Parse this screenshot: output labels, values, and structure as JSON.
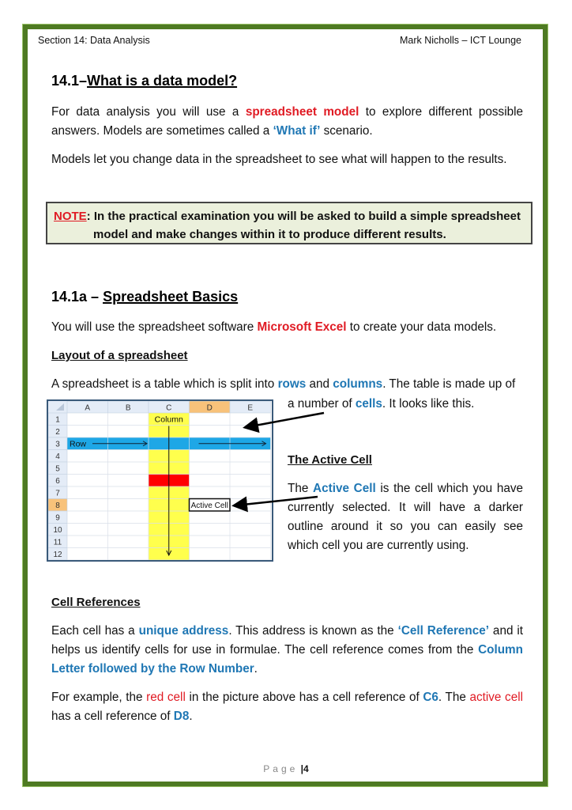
{
  "header": {
    "left": "Section 14: Data Analysis",
    "right": "Mark Nicholls – ICT Lounge"
  },
  "section1": {
    "number": "14.1–",
    "title": "What is a data model?",
    "para1": {
      "pre": "For data analysis you will use a ",
      "highlight": "spreadsheet model",
      "mid": " to explore different possible answers. Models are sometimes called a ",
      "highlight2": "‘What if’",
      "post": " scenario."
    },
    "para2": "Models let you change data in the spreadsheet to see what will happen to the results."
  },
  "note": {
    "label": "NOTE",
    "line1": ": In the practical examination you will be asked to build a simple spreadsheet",
    "line2": "model and make changes within it to produce different results."
  },
  "section1a": {
    "number": "14.1a – ",
    "title": "Spreadsheet Basics",
    "para1": {
      "pre": "You will use the spreadsheet software ",
      "highlight": "Microsoft Excel",
      "post": " to create your data models."
    },
    "layout_heading": "Layout of a spreadsheet",
    "layout_para": {
      "pre": "A spreadsheet is a table which is split into ",
      "rows": "rows",
      "and": " and ",
      "columns": "columns",
      "post": ". The table is made up of",
      "line2_pre": "a number of ",
      "cells": "cells",
      "line2_post": ". It looks like this."
    },
    "active_heading": "The Active Cell",
    "active_para": {
      "pre": "The ",
      "highlight": "Active Cell",
      "post": " is the cell which you have currently selected. It will have a darker outline around it so you can easily see which cell you are currently using."
    }
  },
  "spreadsheet": {
    "columns": [
      "A",
      "B",
      "C",
      "D",
      "E"
    ],
    "rows": [
      "1",
      "2",
      "3",
      "4",
      "5",
      "6",
      "7",
      "8",
      "9",
      "10",
      "11",
      "12"
    ],
    "column_label": "Column",
    "row_label": "Row",
    "active_cell_label": "Active Cell",
    "highlighted_column": "C",
    "highlighted_row": "3",
    "red_cell": "C6",
    "active_cell": "D8",
    "colors": {
      "column_fill": "#ffff4d",
      "row_fill": "#1ea7e6",
      "red_cell": "#ff0000",
      "header_active": "#f8c27a",
      "header": "#e4ecf7"
    }
  },
  "cell_refs": {
    "heading": "Cell References",
    "para1": {
      "pre": "Each cell has a ",
      "h1": "unique address",
      "mid": ". This address is known as the ",
      "h2": "‘Cell Reference’",
      "mid2": " and it helps us identify cells for use in formulae. The cell reference comes from the ",
      "h3": "Column Letter followed by the Row Number",
      "post": "."
    },
    "para2": {
      "pre": "For example, the ",
      "r1": "red cell",
      "mid": " in the picture above has a cell reference of ",
      "b1": "C6",
      "mid2": ". The ",
      "r2": "active cell",
      "mid3": " has a cell reference of ",
      "b2": "D8",
      "post": "."
    }
  },
  "footer": {
    "page_label": "Page",
    "page_number": "4"
  }
}
